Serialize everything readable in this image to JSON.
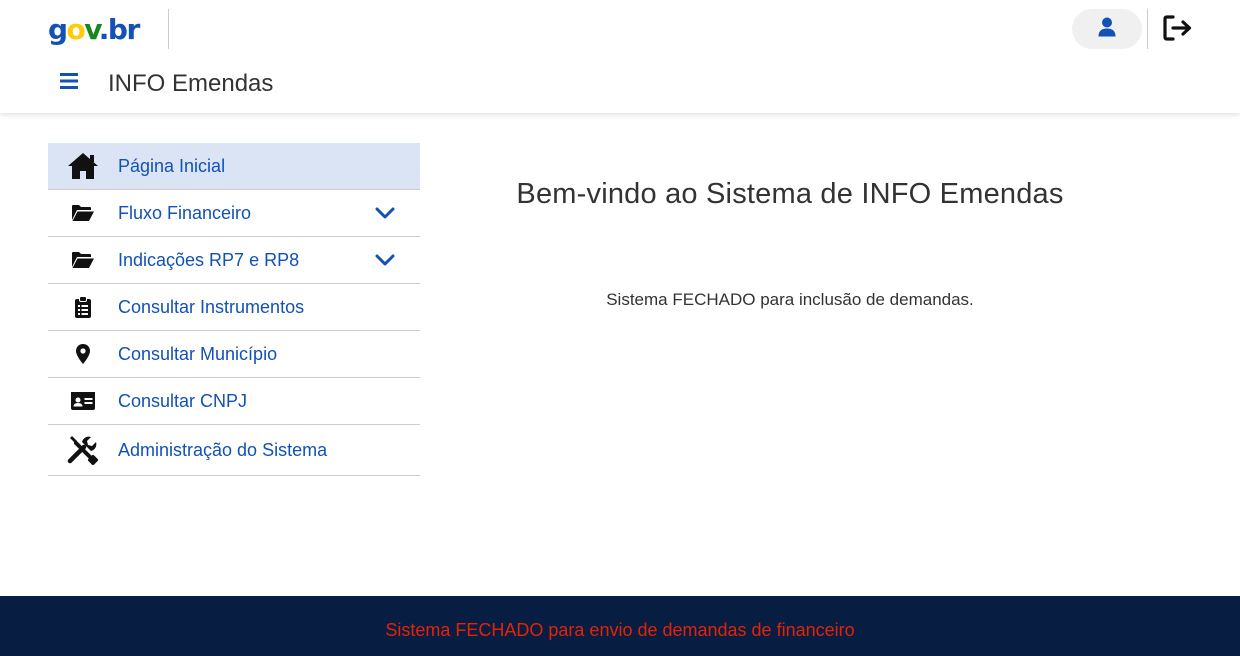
{
  "header": {
    "logo_text": "gov.br",
    "app_title": "INFO Emendas"
  },
  "sidebar": {
    "items": [
      {
        "label": "Página Inicial",
        "icon": "home-icon",
        "active": true,
        "expandable": false
      },
      {
        "label": "Fluxo Financeiro",
        "icon": "folder-open-icon",
        "active": false,
        "expandable": true
      },
      {
        "label": "Indicações RP7 e RP8",
        "icon": "folder-open-icon",
        "active": false,
        "expandable": true
      },
      {
        "label": "Consultar Instrumentos",
        "icon": "clipboard-list-icon",
        "active": false,
        "expandable": false
      },
      {
        "label": "Consultar Município",
        "icon": "map-marker-icon",
        "active": false,
        "expandable": false
      },
      {
        "label": "Consultar CNPJ",
        "icon": "id-card-icon",
        "active": false,
        "expandable": false
      },
      {
        "label": "Administração do Sistema",
        "icon": "tools-icon",
        "active": false,
        "expandable": false
      }
    ]
  },
  "main": {
    "welcome_title": "Bem-vindo ao Sistema de INFO Emendas",
    "status_message": "Sistema FECHADO para inclusão de demandas."
  },
  "footer": {
    "message": "Sistema FECHADO para envio de demandas de financeiro"
  },
  "colors": {
    "primary": "#1351b4",
    "active_bg": "#dbe4f5",
    "footer_bg": "#071d41",
    "footer_text": "#e52207"
  }
}
